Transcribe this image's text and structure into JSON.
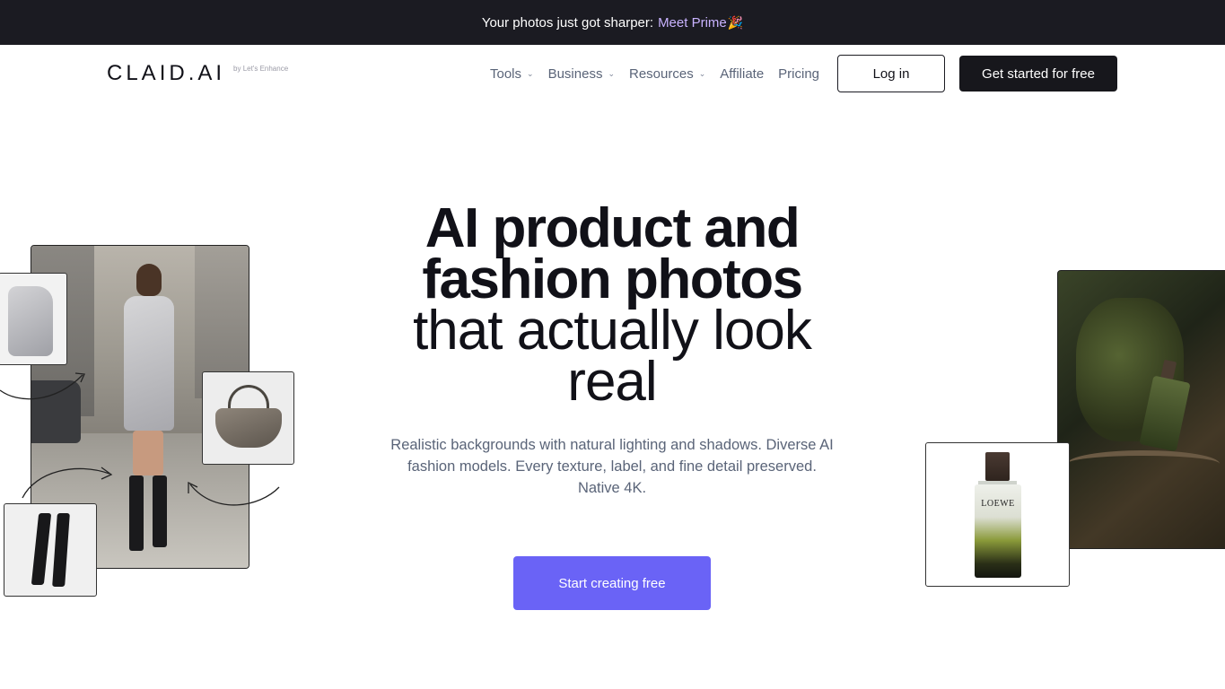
{
  "promo": {
    "text": "Your photos just got sharper:",
    "link": "Meet Prime",
    "emoji": "🎉"
  },
  "logo": {
    "word": "CLAID.AI",
    "sub": "by Let's Enhance"
  },
  "nav": {
    "items": [
      {
        "label": "Tools",
        "dropdown": true
      },
      {
        "label": "Business",
        "dropdown": true
      },
      {
        "label": "Resources",
        "dropdown": true
      },
      {
        "label": "Affiliate",
        "dropdown": false
      },
      {
        "label": "Pricing",
        "dropdown": false
      }
    ],
    "login": "Log in",
    "get_started": "Get started for free"
  },
  "hero": {
    "title_bold_1": "AI product and",
    "title_bold_2": "fashion photos",
    "title_light_1": "that actually look",
    "title_light_2": "real",
    "subtitle": "Realistic backgrounds with natural lighting and shadows. Diverse AI fashion models. Every texture, label, and fine detail preserved. Native 4K.",
    "cta": "Start creating free"
  },
  "collage": {
    "perfume_label": "LOEWE"
  },
  "colors": {
    "promo_bg": "#1b1b22",
    "promo_link": "#c9b3ff",
    "cta": "#6a63f6",
    "dark_button": "#17171c"
  }
}
